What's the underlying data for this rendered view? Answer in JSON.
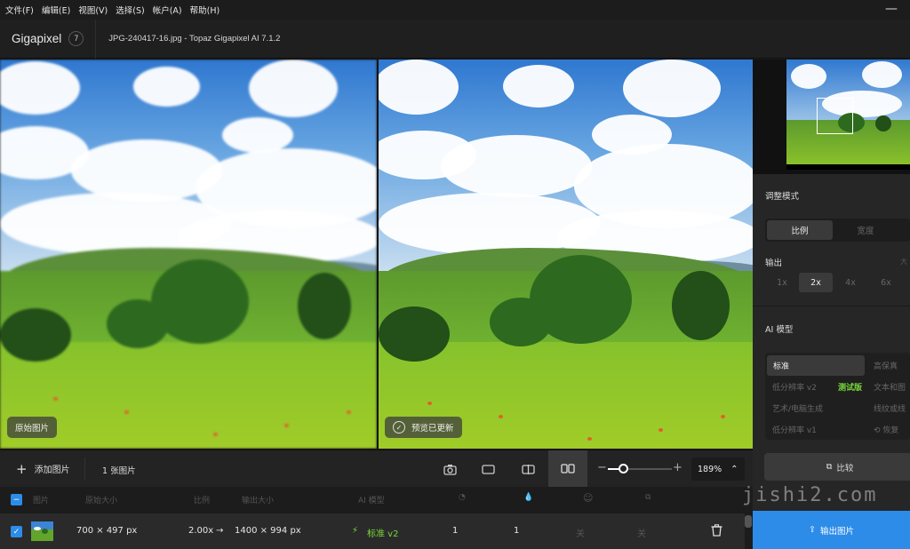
{
  "menu": [
    "文件(F)",
    "编辑(E)",
    "视图(V)",
    "选择(S)",
    "帐户(A)",
    "帮助(H)"
  ],
  "window": {
    "minimize_icon": "minus-icon"
  },
  "app": {
    "name": "Gigapixel",
    "badge": "7",
    "file_title": "JPG-240417-16.jpg - Topaz Gigapixel AI 7.1.2"
  },
  "viewer": {
    "left_label": "原始图片",
    "right_label": "预览已更新"
  },
  "sidebar": {
    "adjust_title": "调整模式",
    "mode_options": [
      "比例",
      "宽度"
    ],
    "mode_selected": "比例",
    "output_title": "输出",
    "output_extra": "大",
    "scale_options": [
      "1x",
      "2x",
      "4x",
      "6x"
    ],
    "scale_selected": "2x",
    "ai_model_title": "AI 模型",
    "models": {
      "standard": "标准",
      "high_fidelity": "高保真",
      "low_res": "低分辨率 v2",
      "beta": "测试版",
      "text": "文本和图",
      "art": "艺术/电脑生成",
      "line": "线纹或线",
      "low_res_v1": "低分辨率 v1",
      "restore": "恢复"
    },
    "compare_label": "比较",
    "export_label": "输出图片"
  },
  "toolbar": {
    "add_label": "添加图片",
    "count_label": "1 张图片",
    "zoom_value": "189%",
    "zoom_fraction": 0.2
  },
  "table": {
    "headers": {
      "image": "图片",
      "orig_size": "原始大小",
      "scale": "比例",
      "out_size": "输出大小",
      "model": "AI 模型"
    },
    "row": {
      "orig_size": "700 × 497 px",
      "scale": "2.00x",
      "arrow": "→",
      "out_size": "1400 × 994 px",
      "model": "标准 v2",
      "v1": "1",
      "v2": "1",
      "v3": "关",
      "v4": "关"
    }
  },
  "watermark": "jishi2.com"
}
